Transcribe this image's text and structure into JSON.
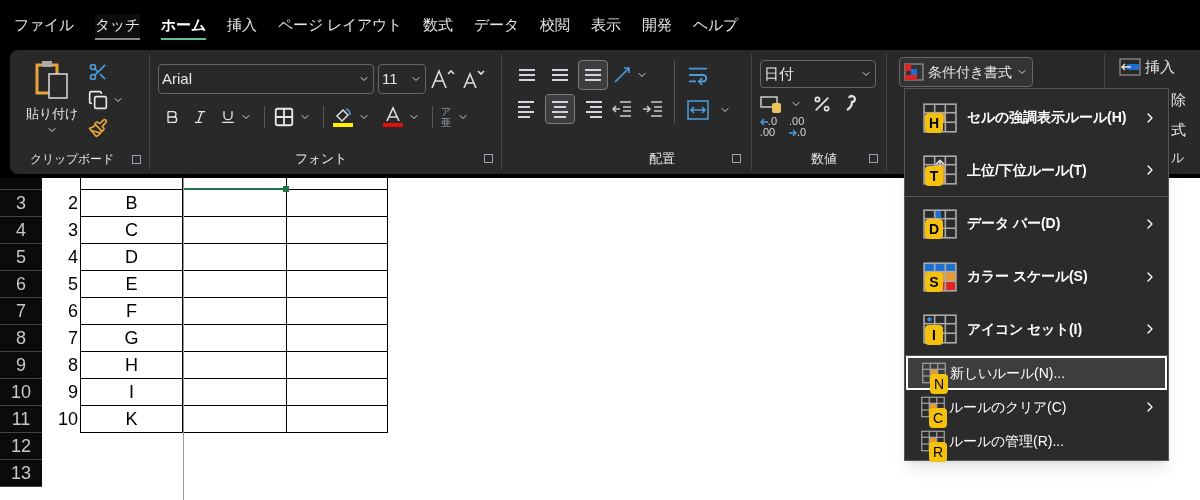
{
  "menu_tabs": [
    {
      "label": "ファイル",
      "selected": false,
      "hovered": false
    },
    {
      "label": "タッチ",
      "selected": false,
      "hovered": true
    },
    {
      "label": "ホーム",
      "selected": true,
      "hovered": false
    },
    {
      "label": "挿入",
      "selected": false,
      "hovered": false
    },
    {
      "label": "ページ レイアウト",
      "selected": false,
      "hovered": false
    },
    {
      "label": "数式",
      "selected": false,
      "hovered": false
    },
    {
      "label": "データ",
      "selected": false,
      "hovered": false
    },
    {
      "label": "校閲",
      "selected": false,
      "hovered": false
    },
    {
      "label": "表示",
      "selected": false,
      "hovered": false
    },
    {
      "label": "開発",
      "selected": false,
      "hovered": false
    },
    {
      "label": "ヘルプ",
      "selected": false,
      "hovered": false
    }
  ],
  "ribbon": {
    "clipboard": {
      "paste_label": "貼り付け",
      "group_label": "クリップボード"
    },
    "font": {
      "font_name": "Arial",
      "font_size": "11",
      "phonetic_top": "ア",
      "phonetic_bottom": "亜",
      "group_label": "フォント"
    },
    "alignment": {
      "vertical": [
        {
          "selected": false
        },
        {
          "selected": false
        },
        {
          "selected": true
        }
      ],
      "horizontal": [
        {
          "selected": false
        },
        {
          "selected": true
        },
        {
          "selected": false
        }
      ],
      "group_label": "配置"
    },
    "number": {
      "format": "日付",
      "decimal_increase": [
        ".0",
        ".00"
      ],
      "decimal_decrease": [
        ".00",
        ".0"
      ],
      "group_label": "数値"
    },
    "styles": {
      "conditional_format_button": "条件付き書式"
    },
    "cells": {
      "insert": "挿入",
      "delete_partial": "除",
      "format_partial": "式",
      "group_partial": "ル"
    }
  },
  "sheet": {
    "row_headers": [
      "3",
      "4",
      "5",
      "6",
      "7",
      "8",
      "9",
      "10",
      "11",
      "12",
      "13"
    ],
    "rows": [
      {
        "number": "2",
        "letter": "B"
      },
      {
        "number": "3",
        "letter": "C"
      },
      {
        "number": "4",
        "letter": "D"
      },
      {
        "number": "5",
        "letter": "E"
      },
      {
        "number": "6",
        "letter": "F"
      },
      {
        "number": "7",
        "letter": "G"
      },
      {
        "number": "8",
        "letter": "H"
      },
      {
        "number": "9",
        "letter": "I"
      },
      {
        "number": "10",
        "letter": "K"
      }
    ]
  },
  "conditional_menu": {
    "items": [
      {
        "kind": "large",
        "label": "セルの強調表示ルール(H)",
        "key": "H",
        "has_submenu": true,
        "highlighted": false
      },
      {
        "kind": "large",
        "label": "上位/下位ルール(T)",
        "key": "T",
        "has_submenu": true,
        "highlighted": false
      },
      {
        "kind": "large",
        "label": "データ バー(D)",
        "key": "D",
        "has_submenu": true,
        "highlighted": false
      },
      {
        "kind": "large",
        "label": "カラー スケール(S)",
        "key": "S",
        "has_submenu": true,
        "highlighted": false
      },
      {
        "kind": "large",
        "label": "アイコン セット(I)",
        "key": "I",
        "has_submenu": true,
        "highlighted": false
      },
      {
        "kind": "small",
        "label": "新しいルール(N)...",
        "key": "N",
        "has_submenu": false,
        "highlighted": true
      },
      {
        "kind": "small",
        "label": "ルールのクリア(C)",
        "key": "C",
        "has_submenu": true,
        "highlighted": false
      },
      {
        "kind": "small",
        "label": "ルールの管理(R)...",
        "key": "R",
        "has_submenu": false,
        "highlighted": false
      }
    ]
  }
}
